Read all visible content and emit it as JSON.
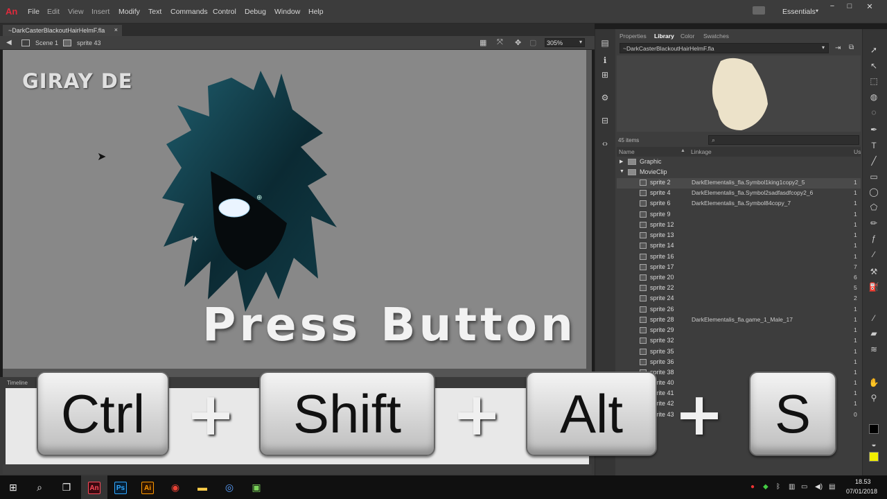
{
  "app": {
    "logo": "An"
  },
  "menu": [
    "File",
    "Edit",
    "View",
    "Insert",
    "Modify",
    "Text",
    "Commands",
    "Control",
    "Debug",
    "Window",
    "Help"
  ],
  "workspace": "Essentials",
  "document": {
    "tab": "~DarkCasterBlackoutHairHelmF.fla",
    "close": "×"
  },
  "breadcrumb": {
    "scene": "Scene 1",
    "symbol": "sprite 43"
  },
  "zoom": "305%",
  "stage": {
    "watermark": "GIRAY DE",
    "headline": "Press Button"
  },
  "timeline": {
    "label": "Timeline"
  },
  "panel": {
    "tabs": [
      "Properties",
      "Library",
      "Color",
      "Swatches"
    ],
    "library_file": "~DarkCasterBlackoutHairHelmF.fla",
    "items_count": "45 items",
    "columns": {
      "name": "Name",
      "linkage": "Linkage",
      "use": "Us"
    },
    "folders": [
      "Graphic",
      "MovieClip"
    ],
    "items": [
      {
        "name": "sprite 2",
        "linkage": "DarkElementalis_fla.Symbol1king1copy2_5",
        "use": "1"
      },
      {
        "name": "sprite 4",
        "linkage": "DarkElementalis_fla.Symbol2sadfasdfcopy2_6",
        "use": "1"
      },
      {
        "name": "sprite 6",
        "linkage": "DarkElementalis_fla.Symbol84copy_7",
        "use": "1"
      },
      {
        "name": "sprite 9",
        "linkage": "",
        "use": "1"
      },
      {
        "name": "sprite 12",
        "linkage": "",
        "use": "1"
      },
      {
        "name": "sprite 13",
        "linkage": "",
        "use": "1"
      },
      {
        "name": "sprite 14",
        "linkage": "",
        "use": "1"
      },
      {
        "name": "sprite 16",
        "linkage": "",
        "use": "1"
      },
      {
        "name": "sprite 17",
        "linkage": "",
        "use": "7"
      },
      {
        "name": "sprite 20",
        "linkage": "",
        "use": "6"
      },
      {
        "name": "sprite 22",
        "linkage": "",
        "use": "5"
      },
      {
        "name": "sprite 24",
        "linkage": "",
        "use": "2"
      },
      {
        "name": "sprite 26",
        "linkage": "",
        "use": "1"
      },
      {
        "name": "sprite 28",
        "linkage": "DarkElementalis_fla.game_1_Male_17",
        "use": "1"
      },
      {
        "name": "sprite 29",
        "linkage": "",
        "use": "1"
      },
      {
        "name": "sprite 32",
        "linkage": "",
        "use": "1"
      },
      {
        "name": "sprite 35",
        "linkage": "",
        "use": "1"
      },
      {
        "name": "sprite 36",
        "linkage": "",
        "use": "1"
      },
      {
        "name": "sprite 38",
        "linkage": "",
        "use": "1"
      },
      {
        "name": "sprite 40",
        "linkage": "",
        "use": "1"
      },
      {
        "name": "sprite 41",
        "linkage": "",
        "use": "1"
      },
      {
        "name": "sprite 42",
        "linkage": "",
        "use": "1"
      },
      {
        "name": "sprite 43",
        "linkage": "alis",
        "use": "0"
      }
    ]
  },
  "overlay_keys": {
    "ctrl": "Ctrl",
    "plus": "+",
    "shift": "Shift",
    "alt": "Alt",
    "s": "S"
  },
  "taskbar": {
    "time": "18.53",
    "date": "07/01/2018",
    "ps": "Ps",
    "ai": "Ai",
    "an": "An"
  },
  "colors": {
    "accent": "#e02a3c",
    "stage_bg": "#888888",
    "fill_swatch": "#f0ee00"
  }
}
